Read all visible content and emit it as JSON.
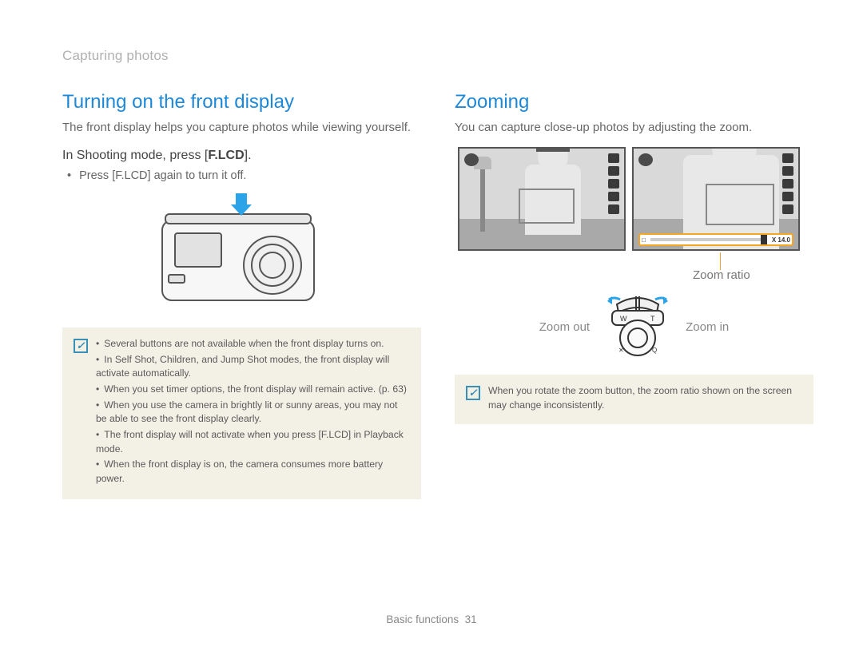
{
  "breadcrumb": "Capturing photos",
  "left": {
    "title": "Turning on the front display",
    "intro": "The front display helps you capture photos while viewing yourself.",
    "instruction_prefix": "In Shooting mode, press [",
    "instruction_key": "F.LCD",
    "instruction_suffix": "].",
    "sub_bullet_prefix": "Press [",
    "sub_bullet_key": "F.LCD",
    "sub_bullet_suffix": "] again to turn it off.",
    "notes": [
      "Several buttons are not available when the front display turns on.",
      "In Self Shot, Children, and Jump Shot modes, the front display will activate automatically.",
      "When you set timer options, the front display will remain active. (p. 63)",
      "When you use the camera in brightly lit or sunny areas, you may not be able to see the front display clearly.",
      "The front display will not activate when you press [F.LCD] in Playback mode.",
      "When the front display is on, the camera consumes more battery power."
    ]
  },
  "right": {
    "title": "Zooming",
    "intro": "You can capture close-up photos by adjusting the zoom.",
    "zoom_ratio_label": "Zoom ratio",
    "zoom_out_label": "Zoom out",
    "zoom_in_label": "Zoom in",
    "zoom_bar_left": "□",
    "zoom_bar_right": "X 14.0",
    "dial_w": "W",
    "dial_t": "T",
    "note": "When you rotate the zoom button, the zoom ratio shown on the screen may change inconsistently."
  },
  "footer_section": "Basic functions",
  "footer_page": "31"
}
